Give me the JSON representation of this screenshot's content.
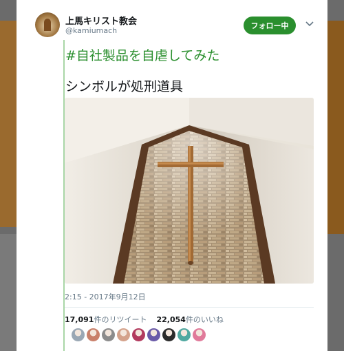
{
  "tweet": {
    "display_name": "上馬キリスト教会",
    "handle": "@kamiumach",
    "follow_label": "フォロー中",
    "hashtag": "#自社製品を自虐してみた",
    "text": "シンボルが処刑道具",
    "timestamp": "2:15 - 2017年9月12日",
    "retweets": {
      "count": "17,091",
      "label": "件のリツイート"
    },
    "likes": {
      "count": "22,054",
      "label": "件のいいね"
    }
  },
  "colors": {
    "accent": "#2a8f2e",
    "thread_line": "#a8d5a6"
  },
  "likers": [
    {
      "icon": "avatar-default",
      "color": "#9aa7b4"
    },
    {
      "icon": "avatar-anime",
      "color": "#c9806a"
    },
    {
      "icon": "avatar-cross",
      "color": "#8c8c8c"
    },
    {
      "icon": "avatar-face",
      "color": "#d4a28b"
    },
    {
      "icon": "avatar-red",
      "color": "#b23a5e"
    },
    {
      "icon": "avatar-purple",
      "color": "#6a5aa8"
    },
    {
      "icon": "avatar-dark",
      "color": "#2b2b2b"
    },
    {
      "icon": "avatar-teal",
      "color": "#4fa8a0"
    },
    {
      "icon": "avatar-pink",
      "color": "#e07a9a"
    }
  ]
}
